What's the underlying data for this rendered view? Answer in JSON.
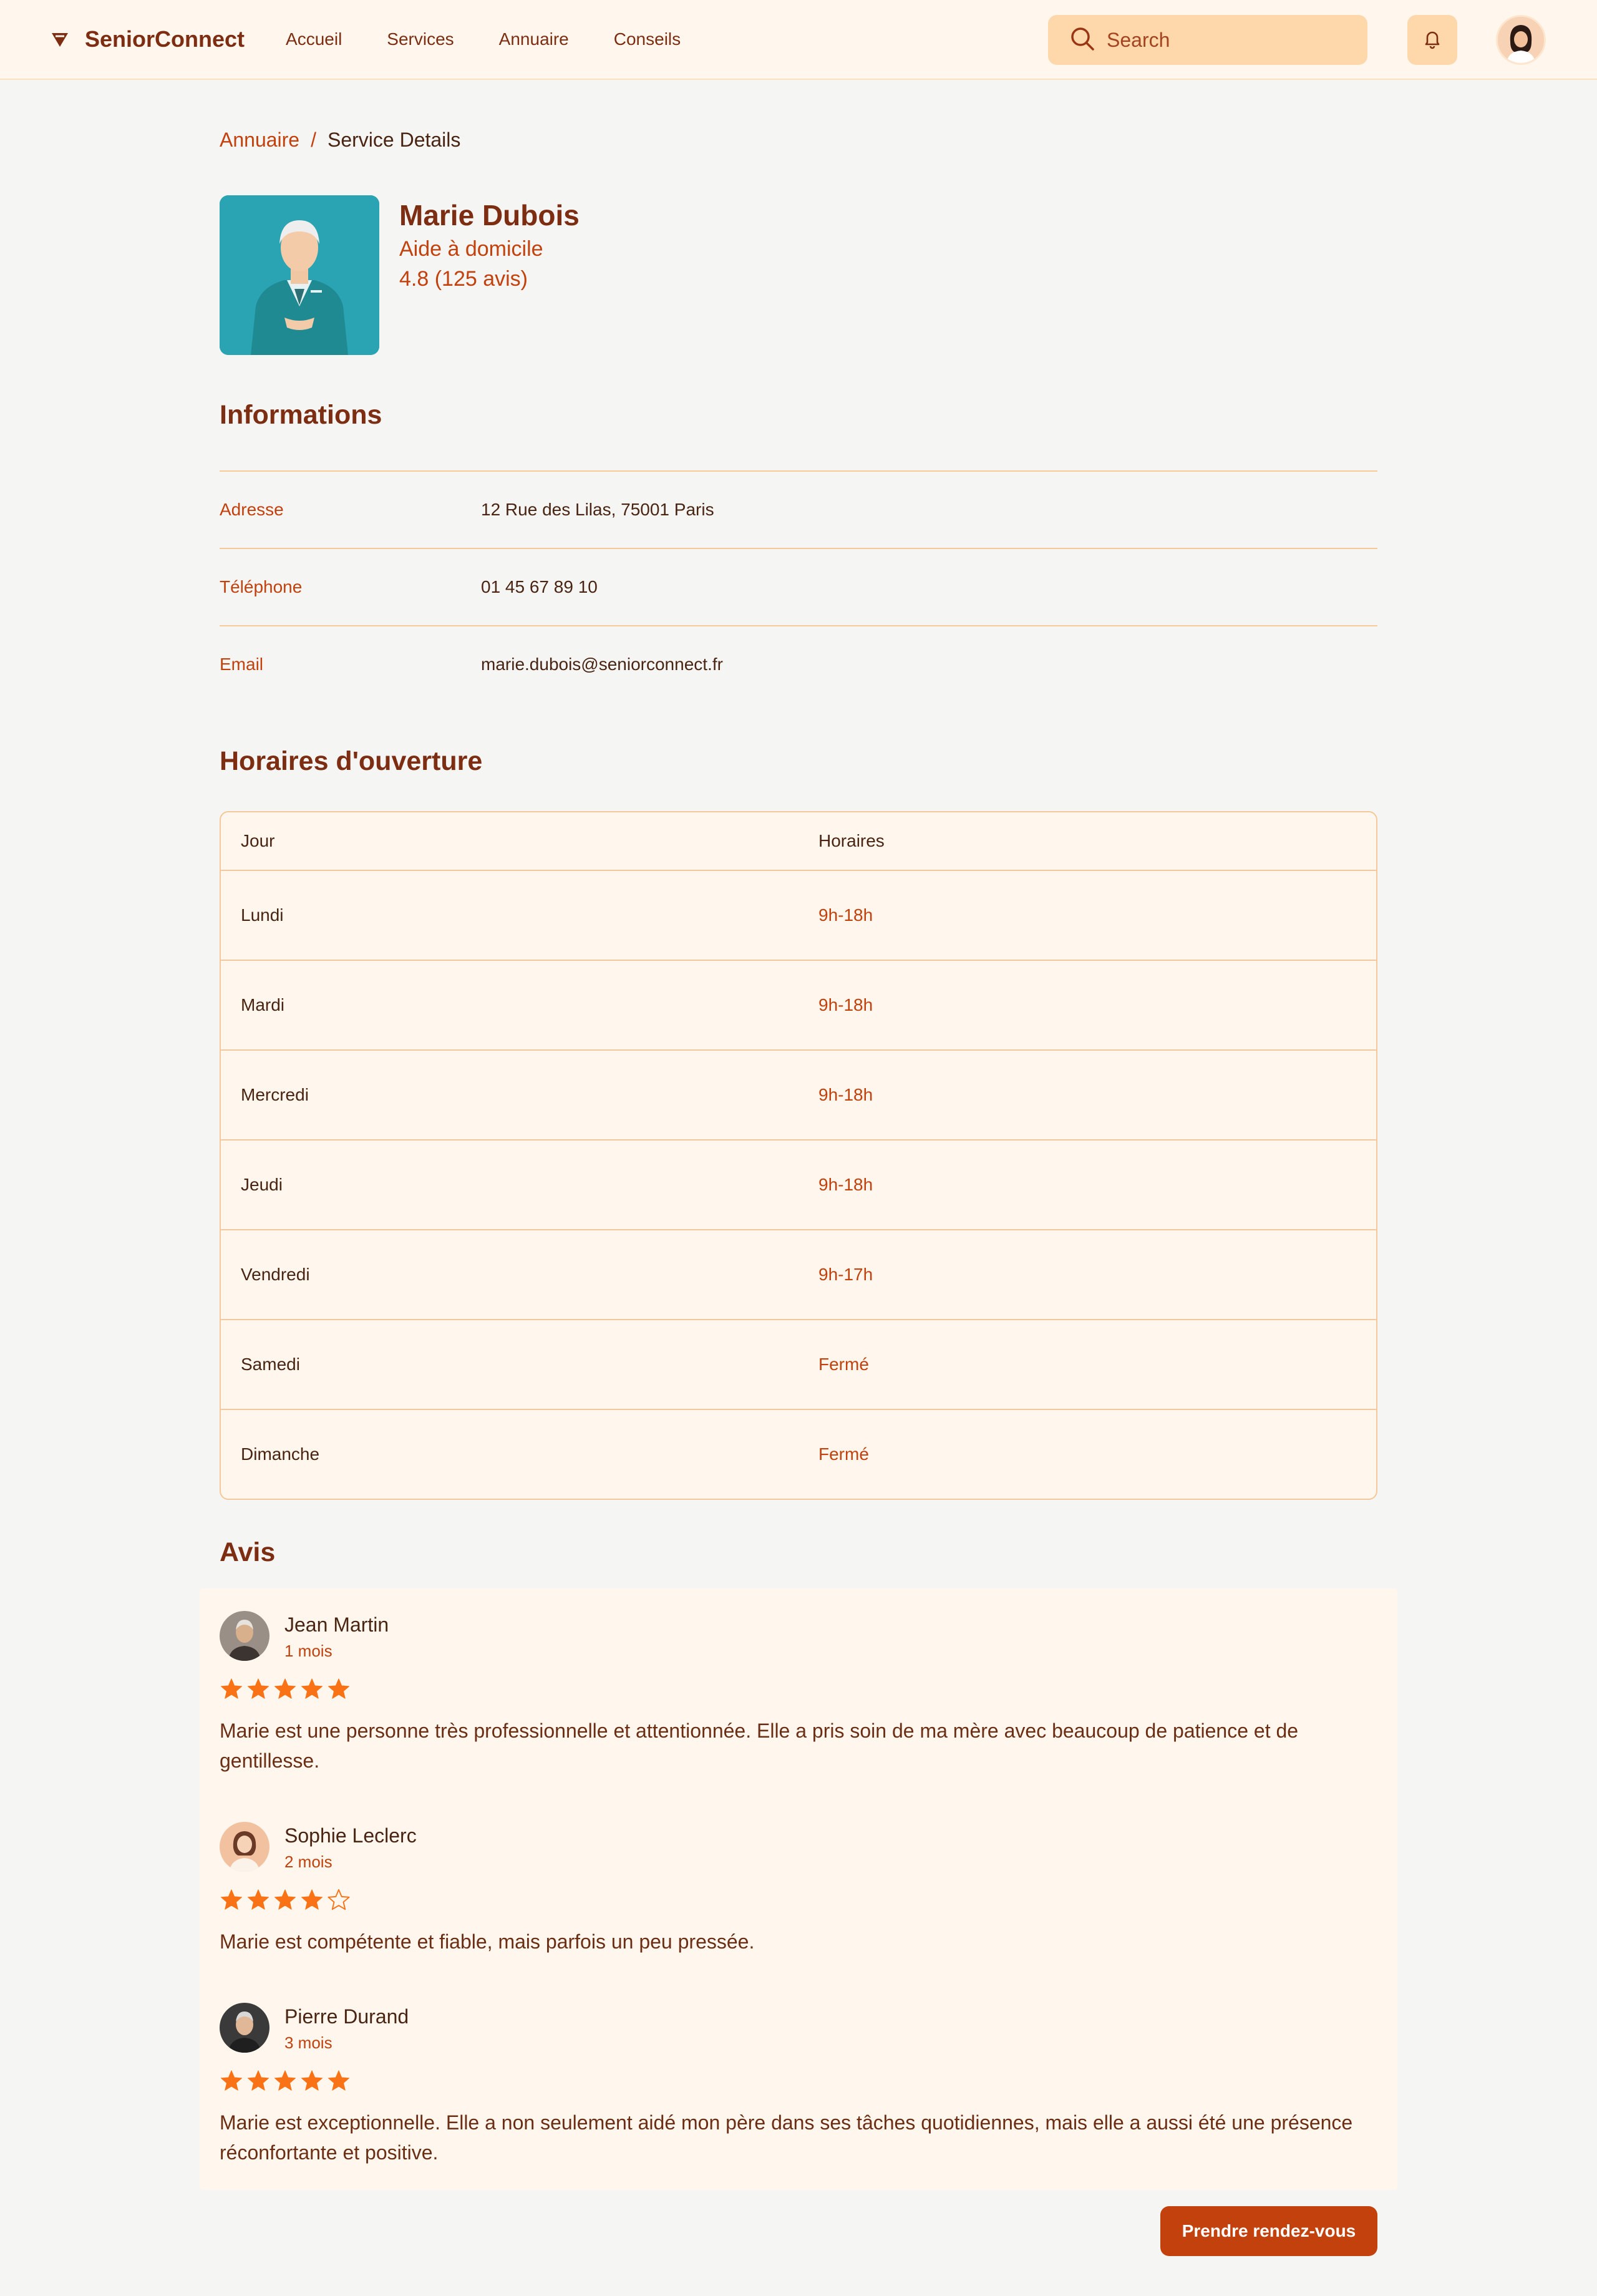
{
  "header": {
    "brand": "SeniorConnect",
    "nav": [
      "Accueil",
      "Services",
      "Annuaire",
      "Conseils"
    ],
    "search_placeholder": "Search"
  },
  "breadcrumb": {
    "parent": "Annuaire",
    "separator": "/",
    "current": "Service Details"
  },
  "profile": {
    "name": "Marie Dubois",
    "role": "Aide à domicile",
    "rating": "4.8 (125 avis)"
  },
  "info": {
    "title": "Informations",
    "rows": [
      {
        "label": "Adresse",
        "value": "12 Rue des Lilas, 75001 Paris"
      },
      {
        "label": "Téléphone",
        "value": "01 45 67 89 10"
      },
      {
        "label": "Email",
        "value": "marie.dubois@seniorconnect.fr"
      }
    ]
  },
  "hours": {
    "title": "Horaires d'ouverture",
    "headers": [
      "Jour",
      "Horaires"
    ],
    "rows": [
      {
        "day": "Lundi",
        "time": "9h-18h"
      },
      {
        "day": "Mardi",
        "time": "9h-18h"
      },
      {
        "day": "Mercredi",
        "time": "9h-18h"
      },
      {
        "day": "Jeudi",
        "time": "9h-18h"
      },
      {
        "day": "Vendredi",
        "time": "9h-17h"
      },
      {
        "day": "Samedi",
        "time": "Fermé"
      },
      {
        "day": "Dimanche",
        "time": "Fermé"
      }
    ]
  },
  "reviews": {
    "title": "Avis",
    "items": [
      {
        "name": "Jean Martin",
        "time": "1 mois",
        "stars": 5,
        "text": "Marie est une personne très professionnelle et attentionnée. Elle a pris soin de ma mère avec beaucoup de patience et de gentillesse."
      },
      {
        "name": "Sophie Leclerc",
        "time": "2 mois",
        "stars": 4,
        "text": "Marie est compétente et fiable, mais parfois un peu pressée."
      },
      {
        "name": "Pierre Durand",
        "time": "3 mois",
        "stars": 5,
        "text": "Marie est exceptionnelle. Elle a non seulement aidé mon père dans ses tâches quotidiennes, mais elle a aussi été une présence réconfortante et positive."
      }
    ]
  },
  "cta": {
    "label": "Prendre rendez-vous"
  },
  "colors": {
    "accent": "#c2410c",
    "star": "#f97316",
    "heading": "#7c2d12"
  }
}
